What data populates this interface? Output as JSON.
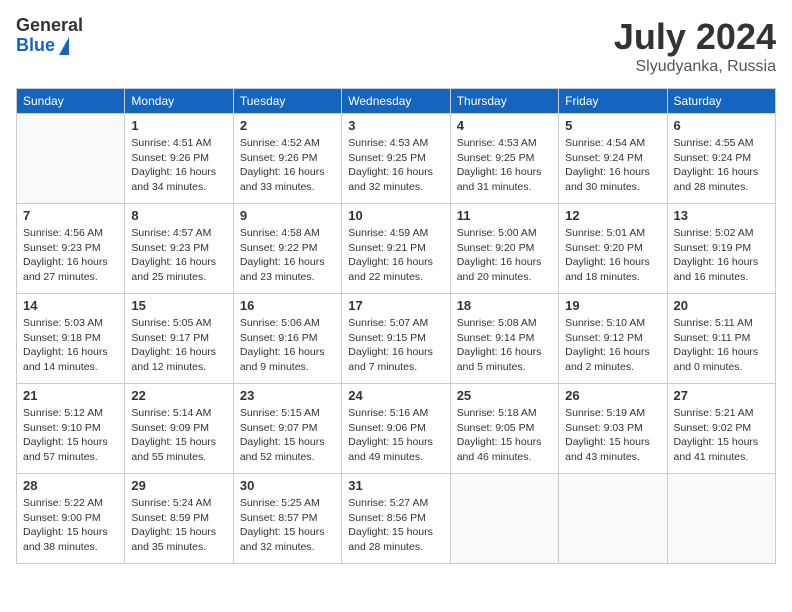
{
  "header": {
    "logo_general": "General",
    "logo_blue": "Blue",
    "title": "July 2024",
    "location": "Slyudyanka, Russia"
  },
  "calendar": {
    "days_of_week": [
      "Sunday",
      "Monday",
      "Tuesday",
      "Wednesday",
      "Thursday",
      "Friday",
      "Saturday"
    ],
    "weeks": [
      [
        {
          "day": "",
          "info": ""
        },
        {
          "day": "1",
          "info": "Sunrise: 4:51 AM\nSunset: 9:26 PM\nDaylight: 16 hours\nand 34 minutes."
        },
        {
          "day": "2",
          "info": "Sunrise: 4:52 AM\nSunset: 9:26 PM\nDaylight: 16 hours\nand 33 minutes."
        },
        {
          "day": "3",
          "info": "Sunrise: 4:53 AM\nSunset: 9:25 PM\nDaylight: 16 hours\nand 32 minutes."
        },
        {
          "day": "4",
          "info": "Sunrise: 4:53 AM\nSunset: 9:25 PM\nDaylight: 16 hours\nand 31 minutes."
        },
        {
          "day": "5",
          "info": "Sunrise: 4:54 AM\nSunset: 9:24 PM\nDaylight: 16 hours\nand 30 minutes."
        },
        {
          "day": "6",
          "info": "Sunrise: 4:55 AM\nSunset: 9:24 PM\nDaylight: 16 hours\nand 28 minutes."
        }
      ],
      [
        {
          "day": "7",
          "info": "Sunrise: 4:56 AM\nSunset: 9:23 PM\nDaylight: 16 hours\nand 27 minutes."
        },
        {
          "day": "8",
          "info": "Sunrise: 4:57 AM\nSunset: 9:23 PM\nDaylight: 16 hours\nand 25 minutes."
        },
        {
          "day": "9",
          "info": "Sunrise: 4:58 AM\nSunset: 9:22 PM\nDaylight: 16 hours\nand 23 minutes."
        },
        {
          "day": "10",
          "info": "Sunrise: 4:59 AM\nSunset: 9:21 PM\nDaylight: 16 hours\nand 22 minutes."
        },
        {
          "day": "11",
          "info": "Sunrise: 5:00 AM\nSunset: 9:20 PM\nDaylight: 16 hours\nand 20 minutes."
        },
        {
          "day": "12",
          "info": "Sunrise: 5:01 AM\nSunset: 9:20 PM\nDaylight: 16 hours\nand 18 minutes."
        },
        {
          "day": "13",
          "info": "Sunrise: 5:02 AM\nSunset: 9:19 PM\nDaylight: 16 hours\nand 16 minutes."
        }
      ],
      [
        {
          "day": "14",
          "info": "Sunrise: 5:03 AM\nSunset: 9:18 PM\nDaylight: 16 hours\nand 14 minutes."
        },
        {
          "day": "15",
          "info": "Sunrise: 5:05 AM\nSunset: 9:17 PM\nDaylight: 16 hours\nand 12 minutes."
        },
        {
          "day": "16",
          "info": "Sunrise: 5:06 AM\nSunset: 9:16 PM\nDaylight: 16 hours\nand 9 minutes."
        },
        {
          "day": "17",
          "info": "Sunrise: 5:07 AM\nSunset: 9:15 PM\nDaylight: 16 hours\nand 7 minutes."
        },
        {
          "day": "18",
          "info": "Sunrise: 5:08 AM\nSunset: 9:14 PM\nDaylight: 16 hours\nand 5 minutes."
        },
        {
          "day": "19",
          "info": "Sunrise: 5:10 AM\nSunset: 9:12 PM\nDaylight: 16 hours\nand 2 minutes."
        },
        {
          "day": "20",
          "info": "Sunrise: 5:11 AM\nSunset: 9:11 PM\nDaylight: 16 hours\nand 0 minutes."
        }
      ],
      [
        {
          "day": "21",
          "info": "Sunrise: 5:12 AM\nSunset: 9:10 PM\nDaylight: 15 hours\nand 57 minutes."
        },
        {
          "day": "22",
          "info": "Sunrise: 5:14 AM\nSunset: 9:09 PM\nDaylight: 15 hours\nand 55 minutes."
        },
        {
          "day": "23",
          "info": "Sunrise: 5:15 AM\nSunset: 9:07 PM\nDaylight: 15 hours\nand 52 minutes."
        },
        {
          "day": "24",
          "info": "Sunrise: 5:16 AM\nSunset: 9:06 PM\nDaylight: 15 hours\nand 49 minutes."
        },
        {
          "day": "25",
          "info": "Sunrise: 5:18 AM\nSunset: 9:05 PM\nDaylight: 15 hours\nand 46 minutes."
        },
        {
          "day": "26",
          "info": "Sunrise: 5:19 AM\nSunset: 9:03 PM\nDaylight: 15 hours\nand 43 minutes."
        },
        {
          "day": "27",
          "info": "Sunrise: 5:21 AM\nSunset: 9:02 PM\nDaylight: 15 hours\nand 41 minutes."
        }
      ],
      [
        {
          "day": "28",
          "info": "Sunrise: 5:22 AM\nSunset: 9:00 PM\nDaylight: 15 hours\nand 38 minutes."
        },
        {
          "day": "29",
          "info": "Sunrise: 5:24 AM\nSunset: 8:59 PM\nDaylight: 15 hours\nand 35 minutes."
        },
        {
          "day": "30",
          "info": "Sunrise: 5:25 AM\nSunset: 8:57 PM\nDaylight: 15 hours\nand 32 minutes."
        },
        {
          "day": "31",
          "info": "Sunrise: 5:27 AM\nSunset: 8:56 PM\nDaylight: 15 hours\nand 28 minutes."
        },
        {
          "day": "",
          "info": ""
        },
        {
          "day": "",
          "info": ""
        },
        {
          "day": "",
          "info": ""
        }
      ]
    ]
  }
}
